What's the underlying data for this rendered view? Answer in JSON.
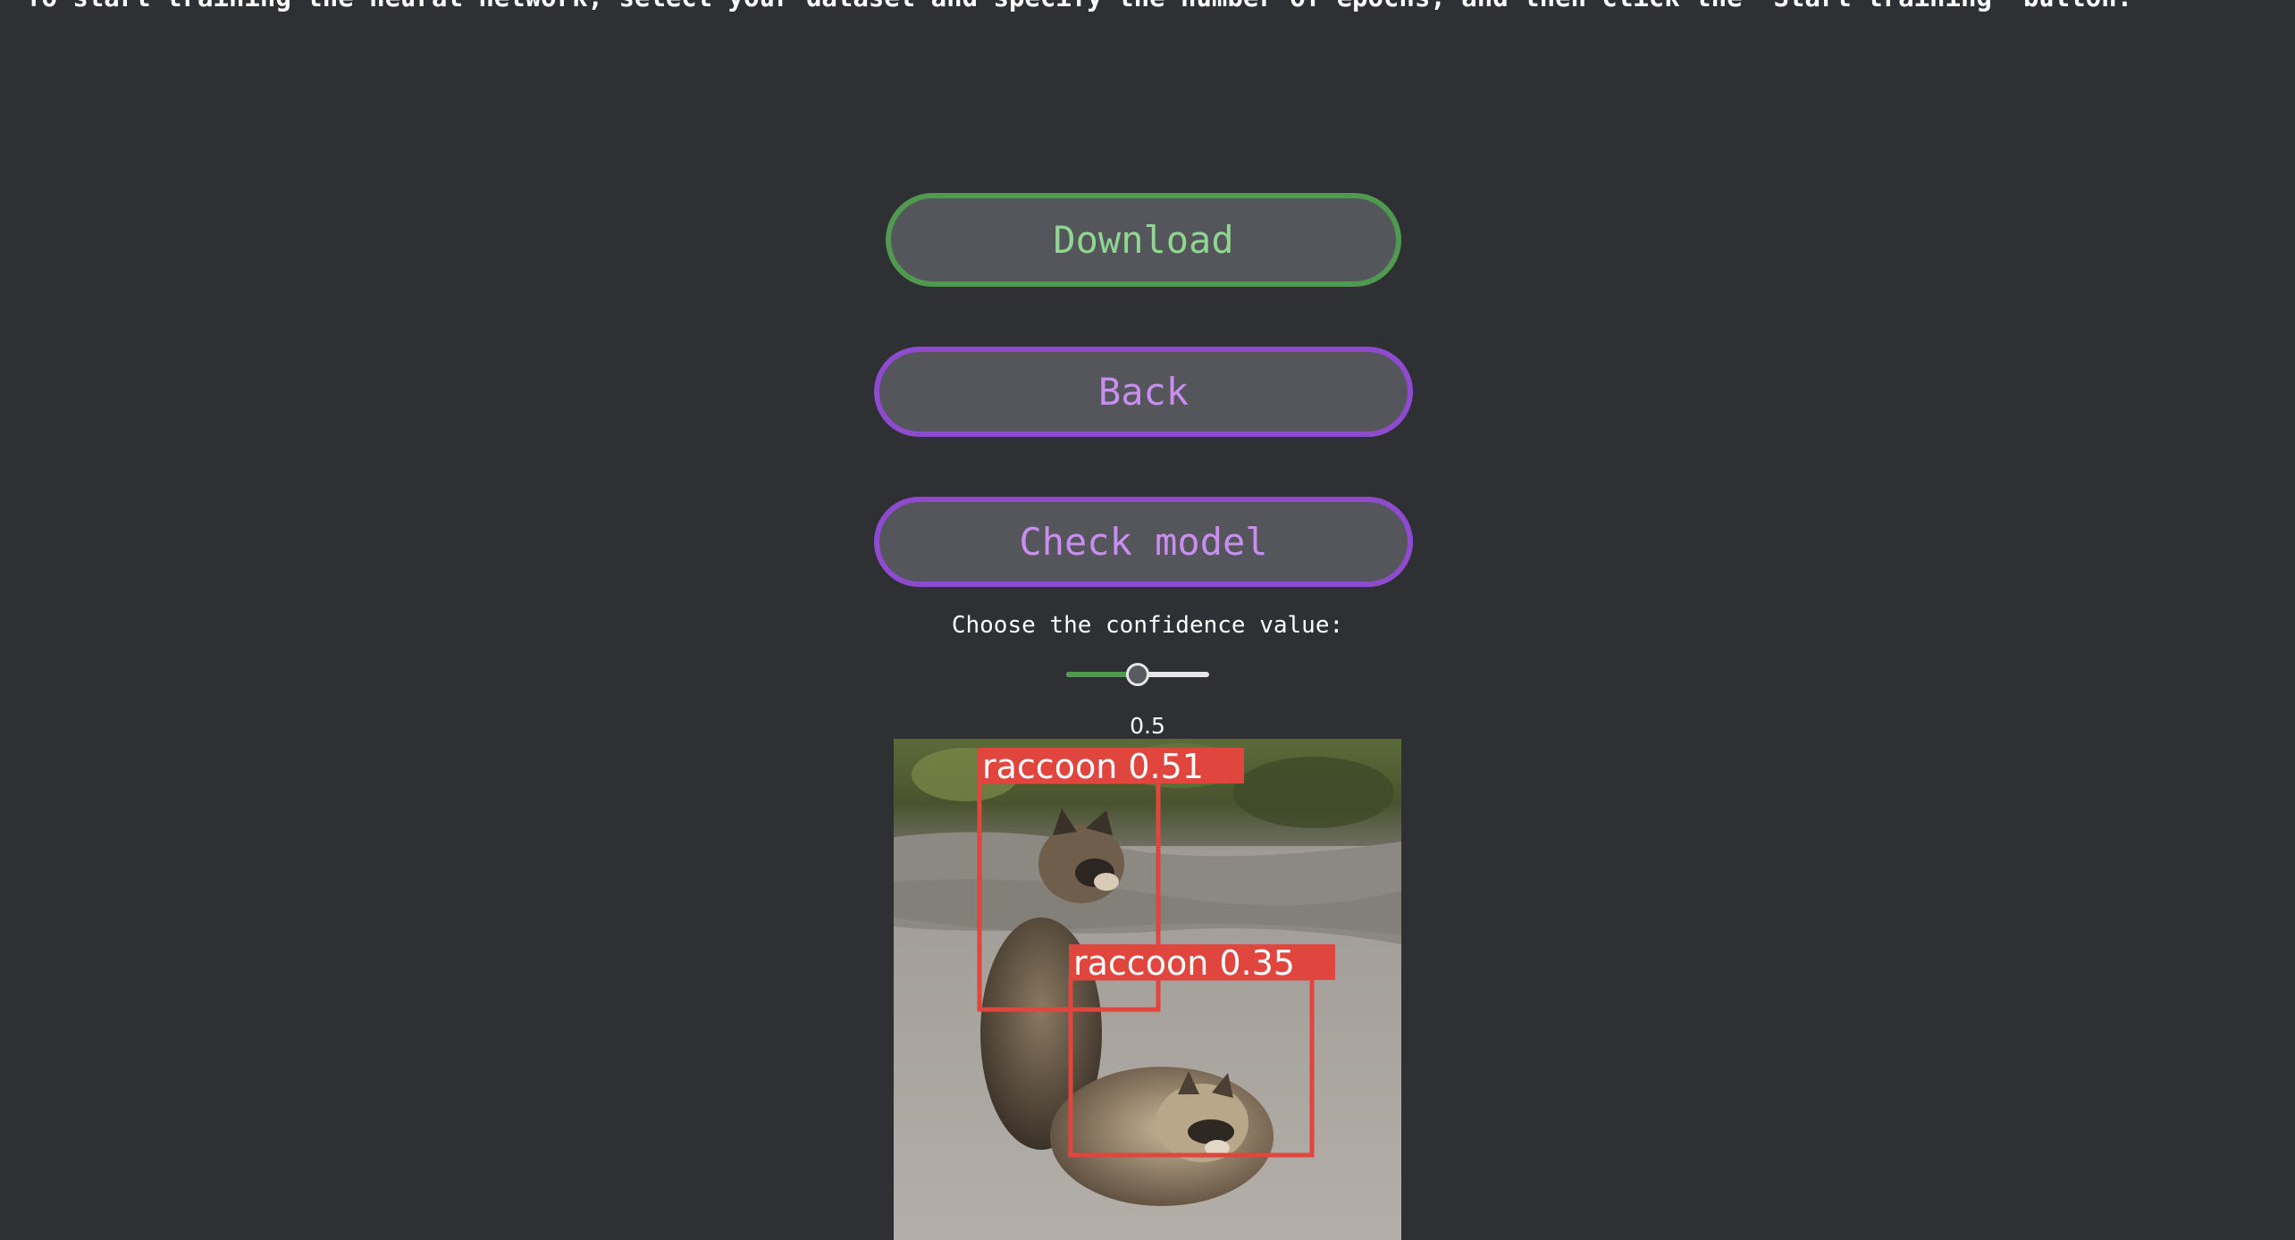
{
  "intro_text": "To start training the neural network, select your dataset and specify the number of epochs, and then click the \"Start training\" button.",
  "buttons": {
    "download": "Download",
    "back": "Back",
    "check_model": "Check model"
  },
  "confidence": {
    "label": "Choose the confidence value:",
    "value": 0.5,
    "value_text": "0.5",
    "min": 0,
    "max": 1
  },
  "result_image": {
    "detections": [
      {
        "label": "raccoon 0.51"
      },
      {
        "label": "raccoon 0.35"
      }
    ]
  },
  "colors": {
    "background": "#2f3033",
    "download_border": "#4f9a4f",
    "download_text": "#8fd690",
    "purple_border": "#8e4bd0",
    "purple_text": "#c98ef0",
    "button_fill": "#55565c",
    "detection_box": "#e0453e"
  }
}
